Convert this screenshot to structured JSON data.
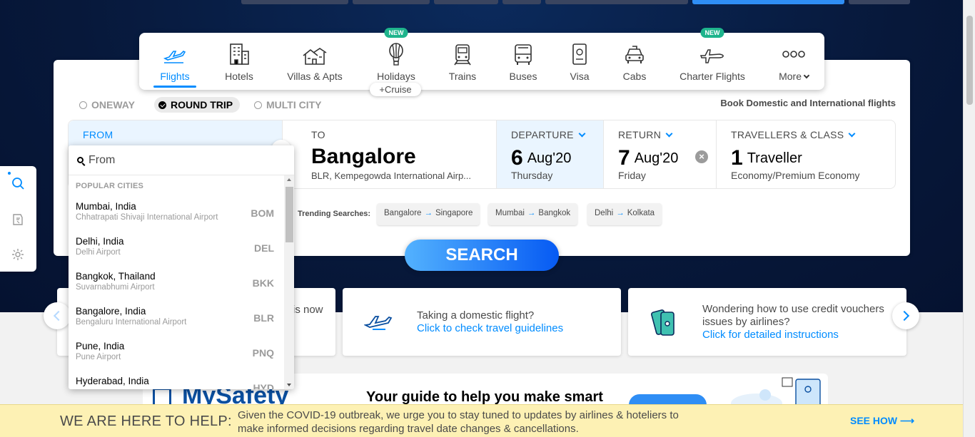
{
  "nav": {
    "items": [
      {
        "label": "Flights",
        "icon": "flight-icon",
        "active": true
      },
      {
        "label": "Hotels",
        "icon": "hotel-icon"
      },
      {
        "label": "Villas & Apts",
        "icon": "villa-icon"
      },
      {
        "label": "Holidays",
        "icon": "hot-air-balloon-icon",
        "badge": "NEW"
      },
      {
        "label": "Trains",
        "icon": "train-icon"
      },
      {
        "label": "Buses",
        "icon": "bus-icon"
      },
      {
        "label": "Visa",
        "icon": "passport-icon"
      },
      {
        "label": "Cabs",
        "icon": "cab-icon"
      },
      {
        "label": "Charter Flights",
        "icon": "charter-plane-icon",
        "badge": "NEW"
      },
      {
        "label": "More",
        "icon": "more-dots-icon"
      }
    ],
    "cruise_tag": "+Cruise"
  },
  "trip_types": {
    "oneway": "ONEWAY",
    "round_trip": "ROUND TRIP",
    "multi_city": "MULTI CITY",
    "selected": "ROUND TRIP"
  },
  "book_text": "Book Domestic and International flights",
  "fields": {
    "from_label": "FROM",
    "to_label": "TO",
    "to_city": "Bangalore",
    "to_airport": "BLR, Kempegowda International Airp...",
    "departure_label": "DEPARTURE",
    "departure_day": "6",
    "departure_month": "Aug'20",
    "departure_weekday": "Thursday",
    "return_label": "RETURN",
    "return_day": "7",
    "return_month": "Aug'20",
    "return_weekday": "Friday",
    "travellers_label": "TRAVELLERS & CLASS",
    "travellers_count": "1",
    "travellers_text": "Traveller",
    "travel_class": "Economy/Premium Economy"
  },
  "dropdown": {
    "placeholder": "From",
    "header": "POPULAR CITIES",
    "cities": [
      {
        "city": "Mumbai, India",
        "airport": "Chhatrapati Shivaji International Airport",
        "code": "BOM"
      },
      {
        "city": "Delhi, India",
        "airport": "Delhi Airport",
        "code": "DEL"
      },
      {
        "city": "Bangkok, Thailand",
        "airport": "Suvarnabhumi Airport",
        "code": "BKK"
      },
      {
        "city": "Bangalore, India",
        "airport": "Bengaluru International Airport",
        "code": "BLR"
      },
      {
        "city": "Pune, India",
        "airport": "Pune Airport",
        "code": "PNQ"
      },
      {
        "city": "Hyderabad, India",
        "airport": "",
        "code": "HYD"
      }
    ]
  },
  "trending": {
    "label": "Trending Searches:",
    "chips": [
      {
        "from": "Bangalore",
        "to": "Singapore"
      },
      {
        "from": "Mumbai",
        "to": "Bangkok"
      },
      {
        "from": "Delhi",
        "to": "Kolkata"
      }
    ],
    "arrow": "→"
  },
  "search_button": "SEARCH",
  "info_cards": [
    {
      "text1": "is now",
      "text2": ""
    },
    {
      "text1": "Taking a domestic flight?",
      "text2": "Click to check travel guidelines"
    },
    {
      "text1": "Wondering how to use credit vouchers",
      "text1b": "issues by airlines?",
      "text2": "Click for detailed instructions"
    }
  ],
  "safety": {
    "title": "MySafety",
    "guide": "Your guide to help you make smart"
  },
  "help_bar": {
    "title": "WE ARE HERE TO HELP:",
    "text": "Given the COVID-19 outbreak, we urge you to stay tuned to updates by airlines & hoteliers to make informed decisions regarding travel date changes & cancellations.",
    "link": "SEE HOW ⟶"
  },
  "colors": {
    "accent": "#008cff",
    "hero": "#07183a",
    "help_bg": "#fdf1b4",
    "new_badge": "#1eb48c"
  }
}
